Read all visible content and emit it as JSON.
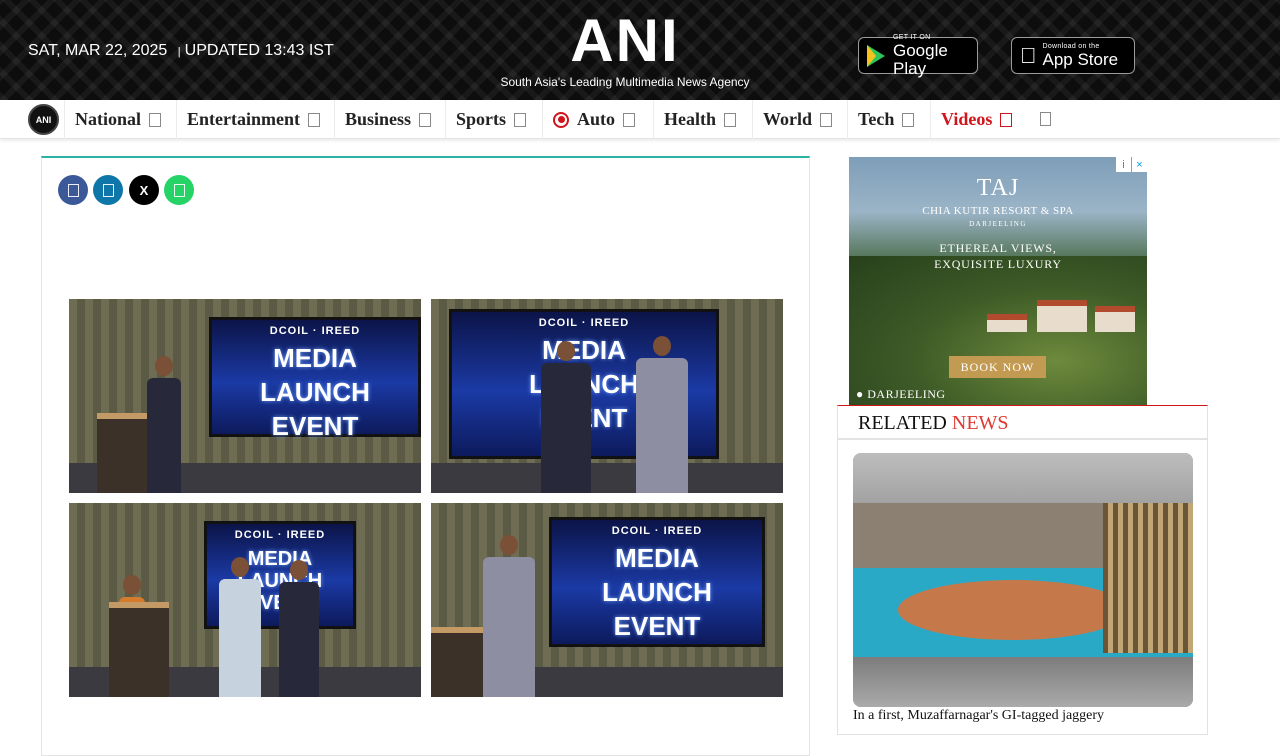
{
  "header": {
    "date": "SAT, MAR 22, 2025",
    "separator": "|",
    "updated": "UPDATED 13:43 IST",
    "logo": "ANI",
    "tagline": "South Asia's Leading Multimedia News Agency",
    "google_play_small": "GET IT ON",
    "google_play_big": "Google Play",
    "app_store_small": "Download on the",
    "app_store_big": "App Store"
  },
  "nav": {
    "logo": "ANI",
    "items": [
      {
        "label": "National"
      },
      {
        "label": "Entertainment"
      },
      {
        "label": "Business"
      },
      {
        "label": "Sports"
      },
      {
        "label": "Auto"
      },
      {
        "label": "Health"
      },
      {
        "label": "World"
      },
      {
        "label": "Tech"
      },
      {
        "label": "Videos"
      }
    ]
  },
  "article": {
    "share_buttons": [
      "facebook",
      "linkedin",
      "x",
      "whatsapp"
    ],
    "share_x_label": "X",
    "photos": [
      {
        "brand": "DCOIL · IREED",
        "headline1": "MEDIA",
        "headline2": "LAUNCH",
        "headline3": "EVENT"
      },
      {
        "brand": "DCOIL · IREED",
        "headline1": "MEDIA",
        "headline2": "LAUNCH",
        "headline3": "EVENT"
      },
      {
        "brand": "DCOIL · IREED",
        "headline1": "MEDIA",
        "headline2": "LAUNCH",
        "headline3": "EVENT"
      },
      {
        "brand": "DCOIL · IREED",
        "headline1": "MEDIA",
        "headline2": "LAUNCH",
        "headline3": "EVENT"
      }
    ]
  },
  "ad": {
    "brand": "TAJ",
    "resort": "CHIA KUTIR RESORT & SPA",
    "place": "DARJEELING",
    "headline1": "ETHEREAL VIEWS,",
    "headline2": "EXQUISITE LUXURY",
    "cta": "BOOK NOW",
    "location": "DARJEELING",
    "info_icon": "i",
    "close_icon": "×"
  },
  "related": {
    "title_1": "RELATED ",
    "title_2": "NEWS",
    "caption": "In a first, Muzaffarnagar's GI-tagged jaggery"
  },
  "colors": {
    "brand_red": "#d0141a",
    "accent_teal": "#29b3a0",
    "facebook": "#3b5998",
    "linkedin": "#0e76a8",
    "x": "#000000",
    "whatsapp": "#25d366"
  }
}
